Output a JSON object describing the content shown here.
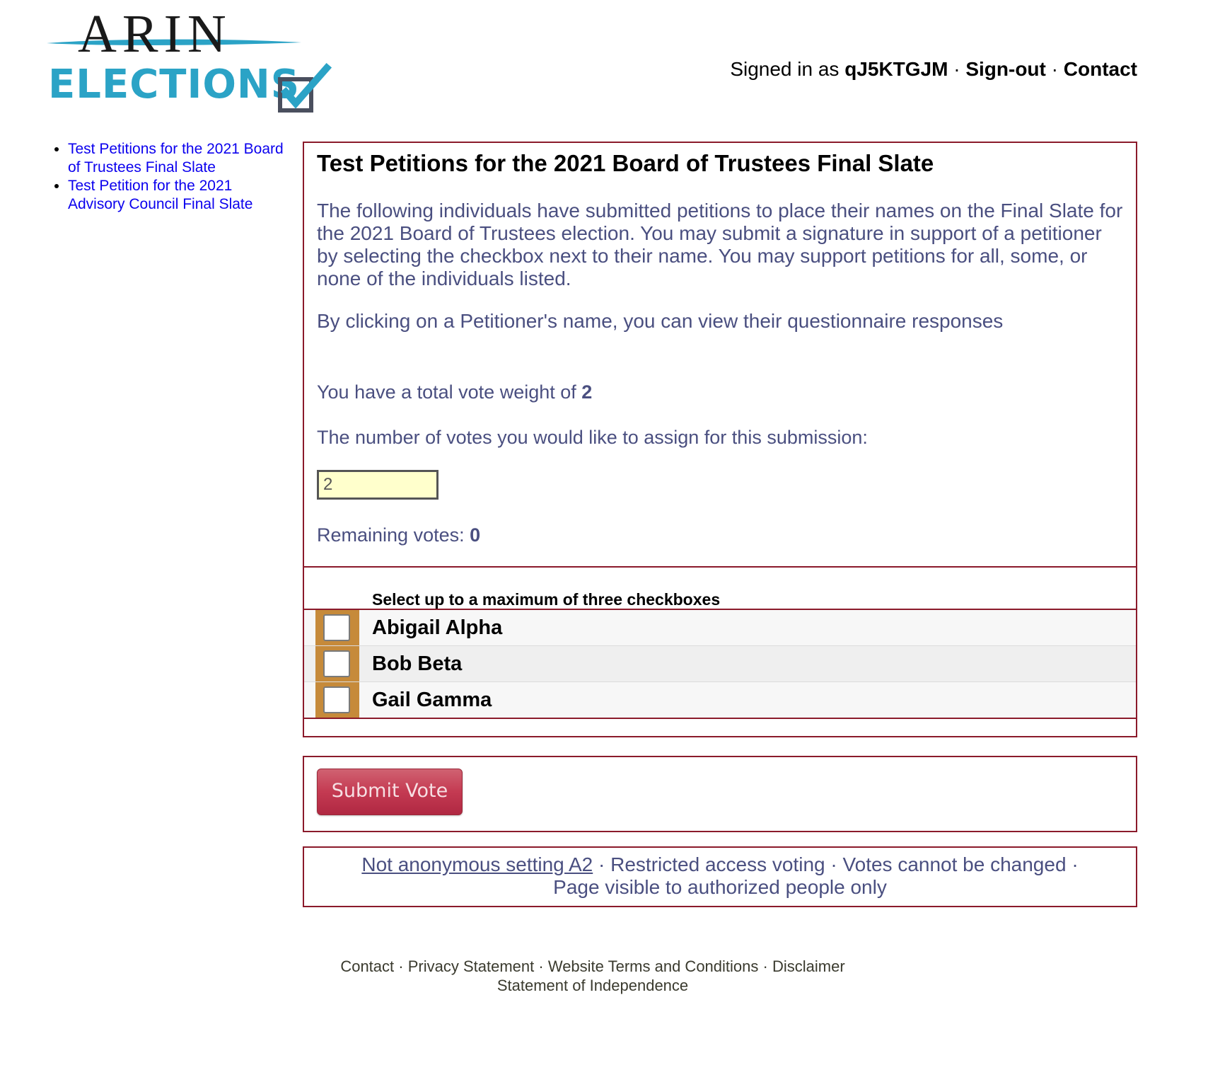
{
  "header": {
    "logo_top": "ARIN",
    "logo_bottom": "ELECTIONS",
    "signed_in_prefix": "Signed in as",
    "username": "qJ5KTGJM",
    "separator": "·",
    "sign_out": "Sign-out",
    "contact": "Contact"
  },
  "sidebar": {
    "items": [
      {
        "label": "Test Petitions for the 2021 Board of Trustees Final Slate"
      },
      {
        "label": "Test Petition for the 2021 Advisory Council Final Slate"
      }
    ]
  },
  "main": {
    "title": "Test Petitions for the 2021 Board of Trustees Final Slate",
    "description": "The following individuals have submitted petitions to place their names on the Final Slate for the 2021 Board of Trustees election. You may submit a signature in support of a petitioner by selecting the checkbox next to their name. You may support petitions for all, some, or none of the individuals listed.",
    "questionnaire_note": "By clicking on a Petitioner's name, you can view their questionnaire responses",
    "weight_prefix": "You have a total vote weight of",
    "weight_value": "2",
    "assign_label": "The number of votes you would like to assign for this submission:",
    "votes_input_value": "2",
    "remaining_prefix": "Remaining votes:",
    "remaining_value": "0",
    "select_heading": "Select up to a maximum of three checkboxes",
    "candidates": [
      {
        "name": "Abigail Alpha"
      },
      {
        "name": "Bob Beta"
      },
      {
        "name": "Gail Gamma"
      }
    ]
  },
  "submit": {
    "label": "Submit Vote"
  },
  "settings": {
    "link": "Not anonymous setting A2",
    "sep": "·",
    "item1": "Restricted access voting",
    "item2": "Votes cannot be changed",
    "item3": "Page visible to authorized people only"
  },
  "footer": {
    "contact": "Contact",
    "privacy": "Privacy Statement",
    "terms": "Website Terms and Conditions",
    "disclaimer": "Disclaimer",
    "independence": "Statement of Independence",
    "sep": "·"
  },
  "colors": {
    "logo_blue": "#2ba3c6",
    "box_border": "#8b1a2b",
    "body_text": "#4a4f80",
    "link_blue": "#0b00ee",
    "checkbox_cell": "#c68a3a",
    "button_red": "#c43a52",
    "input_bg": "#ffffcc"
  }
}
